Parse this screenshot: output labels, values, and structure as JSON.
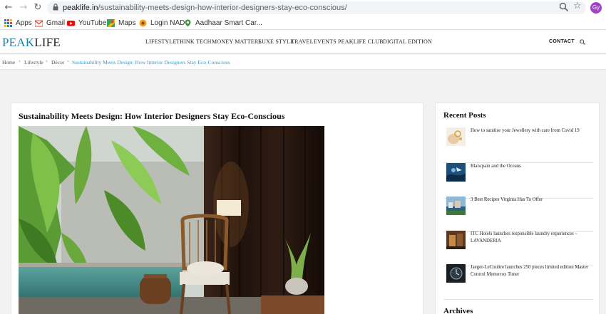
{
  "browser": {
    "url_domain": "peaklife.in",
    "url_path": "/sustainability-meets-design-how-interior-designers-stay-eco-conscious/",
    "profile_initials": "Gy",
    "bookmarks": [
      {
        "label": "Apps",
        "icon": "apps-grid-icon"
      },
      {
        "label": "Gmail",
        "icon": "gmail-icon"
      },
      {
        "label": "YouTube",
        "icon": "youtube-icon"
      },
      {
        "label": "Maps",
        "icon": "maps-icon"
      },
      {
        "label": "Login NAD",
        "icon": "nad-icon"
      },
      {
        "label": "Aadhaar Smart Car...",
        "icon": "aadhaar-icon"
      }
    ]
  },
  "site": {
    "logo_peak": "PEAK",
    "logo_life": "LIFE",
    "menu": [
      "LIFESTYLE",
      "THINK TECH",
      "MONEY MATTERS",
      "LUXE STYLE",
      "TRAVEL",
      "EVENTS",
      "PEAKLIFE CLUB",
      "DIGITAL EDITION"
    ],
    "contact": "CONTACT",
    "accent": "#1f7fa6"
  },
  "breadcrumb": {
    "items": [
      "Home",
      "Lifestyle",
      "Décor"
    ],
    "current": "Sustainability Meets Design: How Interior Designers Stay Eco-Conscious"
  },
  "article": {
    "title": "Sustainability Meets Design: How Interior Designers Stay Eco-Conscious"
  },
  "sidebar": {
    "recent_title": "Recent Posts",
    "posts": [
      {
        "title": "How to sanitise your Jewellery with care from Covid 19"
      },
      {
        "title": "Blancpain and the Oceans"
      },
      {
        "title": "3 Best Recipes Virginia Has To Offer"
      },
      {
        "title": "ITC Hotels launches responsible laundry experiences – LAVANDERIA"
      },
      {
        "title": "Jaeger-LeCoultre launches 250 pieces limited edition Master Control Memovox Timer"
      }
    ],
    "archives_title": "Archives"
  }
}
